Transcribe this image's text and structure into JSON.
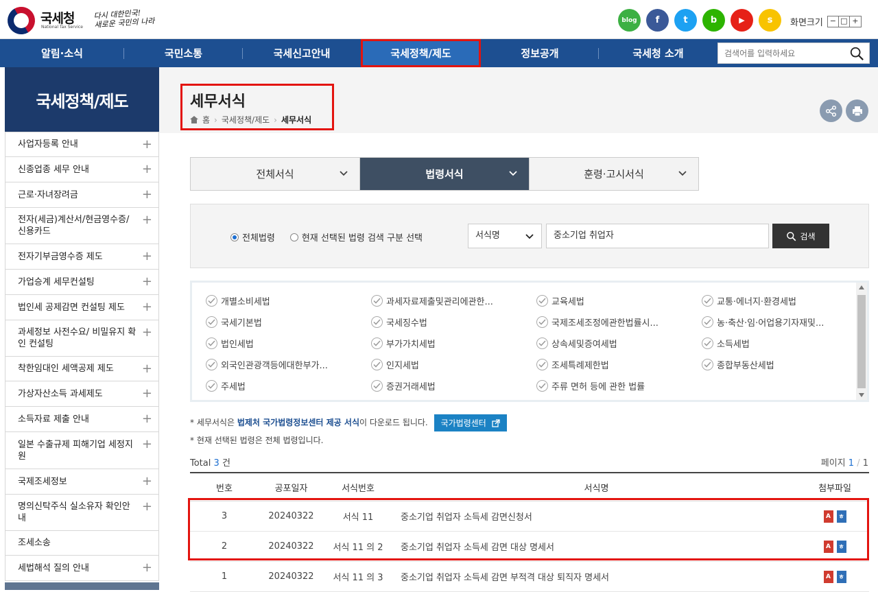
{
  "header": {
    "logo_text": "국세청",
    "logo_sub": "National Tax Service",
    "slogan_line1": "다시 대한민국!",
    "slogan_line2": "새로운 국민의 나라",
    "sns": [
      {
        "name": "blog",
        "label": "blog",
        "color": "#3cb043"
      },
      {
        "name": "facebook",
        "label": "f",
        "color": "#3b5998"
      },
      {
        "name": "twitter",
        "label": "t",
        "color": "#1da1f2"
      },
      {
        "name": "band",
        "label": "b",
        "color": "#2db400"
      },
      {
        "name": "youtube",
        "label": "▶",
        "color": "#e62117"
      },
      {
        "name": "story",
        "label": "s",
        "color": "#f8c300"
      }
    ],
    "font_size_label": "화면크기",
    "font_size_buttons": [
      "−",
      "□",
      "+"
    ]
  },
  "gnb": {
    "items": [
      "알림·소식",
      "국민소통",
      "국세신고안내",
      "국세정책/제도",
      "정보공개",
      "국세청 소개"
    ],
    "active_index": 3,
    "search_placeholder": "검색어를 입력하세요"
  },
  "lnb": {
    "title": "국세정책/제도",
    "items": [
      {
        "label": "사업자등록 안내",
        "plus": true
      },
      {
        "label": "신종업종 세무 안내",
        "plus": true
      },
      {
        "label": "근로·자녀장려금",
        "plus": true
      },
      {
        "label": "전자(세금)계산서/현금영수증/ 신용카드",
        "plus": true
      },
      {
        "label": "전자기부금영수증 제도",
        "plus": true
      },
      {
        "label": "가업승계 세무컨설팅",
        "plus": true
      },
      {
        "label": "법인세 공제감면 컨설팅 제도",
        "plus": true
      },
      {
        "label": "과세정보 사전수요/ 비밀유지 확인 컨설팅",
        "plus": true
      },
      {
        "label": "착한임대인 세액공제 제도",
        "plus": true
      },
      {
        "label": "가상자산소득 과세제도",
        "plus": true
      },
      {
        "label": "소득자료 제출 안내",
        "plus": true
      },
      {
        "label": "일본 수출규제 피해기업 세정지원",
        "plus": true
      },
      {
        "label": "국제조세정보",
        "plus": true
      },
      {
        "label": "명의신탁주식 실소유자 확인안내",
        "plus": true
      },
      {
        "label": "조세소송",
        "plus": false
      },
      {
        "label": "세법해석 질의 안내",
        "plus": true
      }
    ]
  },
  "page": {
    "title": "세무서식",
    "breadcrumb": [
      "홈",
      "국세정책/제도",
      "세무서식"
    ]
  },
  "tabs": {
    "items": [
      "전체서식",
      "법령서식",
      "훈령·고시서식"
    ],
    "active_index": 1
  },
  "filter": {
    "radio_all": "전체법령",
    "radio_selected": "현재 선택된 법령 검색 구분 선택",
    "select_value": "서식명",
    "query": "중소기업 취업자",
    "search_button": "검색"
  },
  "laws": [
    "개별소비세법",
    "과세자료제출및관리에관한...",
    "교육세법",
    "교통·에너지·환경세법",
    "국세기본법",
    "국세징수법",
    "국제조세조정에관한법률시...",
    "농·축산·임·어업용기자재및...",
    "법인세법",
    "부가가치세법",
    "상속세및증여세법",
    "소득세법",
    "외국인관광객등에대한부가...",
    "인지세법",
    "조세특례제한법",
    "종합부동산세법",
    "주세법",
    "증권거래세법",
    "주류 면허 등에 관한 법률"
  ],
  "notes": {
    "line1_prefix": "* 세무서식은 ",
    "line1_bold": "법제처 국가법령정보센터 제공 서식",
    "line1_suffix": "이 다운로드 됩니다.",
    "button": "국가법령센터",
    "line2": "* 현재 선택된 법령은 전체 법령입니다."
  },
  "result": {
    "total_label": "Total",
    "total_count": "3",
    "total_unit": "건",
    "page_label": "페이지",
    "page_current": "1",
    "page_total": "1",
    "columns": [
      "번호",
      "공포일자",
      "서식번호",
      "서식명",
      "첨부파일"
    ],
    "rows": [
      {
        "no": "3",
        "date": "20240322",
        "form_no": "서식 11",
        "name": "중소기업 취업자 소득세 감면신청서"
      },
      {
        "no": "2",
        "date": "20240322",
        "form_no": "서식 11 의 2",
        "name": "중소기업 취업자 소득세 감면 대상 명세서"
      },
      {
        "no": "1",
        "date": "20240322",
        "form_no": "서식 11 의 3",
        "name": "중소기업 취업자 소득세 감면 부적격 대상 퇴직자 명세서"
      }
    ]
  }
}
